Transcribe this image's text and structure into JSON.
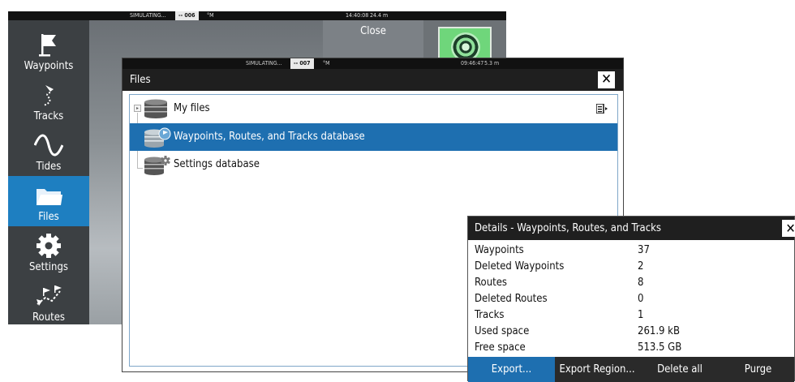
{
  "back_screen": {
    "status": {
      "mode": "SIMULATING...",
      "gps": "-- 006",
      "unit": "°M",
      "time": "14:40:08",
      "depth": "24.4 m"
    },
    "close_label": "Close",
    "sidebar": [
      {
        "label": "Waypoints",
        "icon": "flag-icon"
      },
      {
        "label": "Tracks",
        "icon": "tracks-icon"
      },
      {
        "label": "Tides",
        "icon": "tides-icon"
      },
      {
        "label": "Files",
        "icon": "folder-icon",
        "active": true
      },
      {
        "label": "Settings",
        "icon": "gear-icon"
      },
      {
        "label": "Routes",
        "icon": "routes-icon"
      }
    ]
  },
  "files_window": {
    "status": {
      "mode": "SIMULATING...",
      "gps": "-- 007",
      "unit": "°M",
      "time": "09:46:47",
      "depth": "5.3 m"
    },
    "title": "Files",
    "close_glyph": "✕",
    "items": [
      {
        "label": "My files",
        "icon": "database-icon"
      },
      {
        "label": "Waypoints, Routes, and Tracks database",
        "icon": "database-flag-icon",
        "selected": true
      },
      {
        "label": "Settings database",
        "icon": "database-gear-icon"
      }
    ]
  },
  "details": {
    "title": "Details - Waypoints, Routes, and Tracks",
    "close_glyph": "✕",
    "rows": [
      {
        "key": "Waypoints",
        "value": "37"
      },
      {
        "key": "Deleted Waypoints",
        "value": "2"
      },
      {
        "key": "Routes",
        "value": "8"
      },
      {
        "key": "Deleted Routes",
        "value": "0"
      },
      {
        "key": "Tracks",
        "value": "1"
      },
      {
        "key": "Used space",
        "value": "261.9 kB"
      },
      {
        "key": "Free space",
        "value": "513.5 GB"
      }
    ],
    "buttons": [
      {
        "label": "Export...",
        "active": true
      },
      {
        "label": "Export Region..."
      },
      {
        "label": "Delete all"
      },
      {
        "label": "Purge"
      }
    ]
  },
  "colors": {
    "accent": "#1e6fb0",
    "titlebar": "#1f1f1f",
    "sidebar": "#3c4043"
  }
}
